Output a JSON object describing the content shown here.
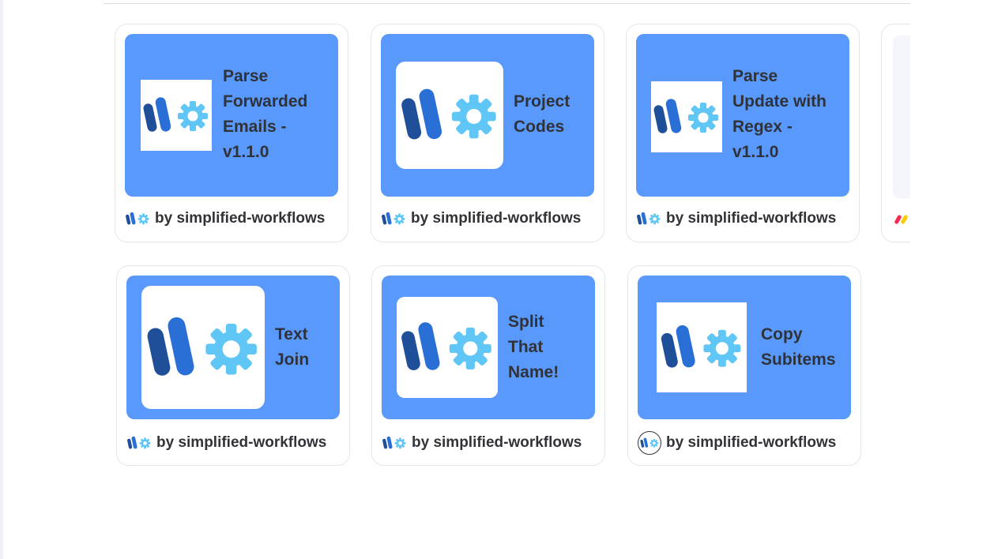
{
  "cards": [
    {
      "title": "Parse\nForwarded\nEmails -\nv1.1.0",
      "byline": "by simplified-workflows"
    },
    {
      "title": "Project\nCodes",
      "byline": "by simplified-workflows"
    },
    {
      "title": "Parse\nUpdate with\nRegex -\nv1.1.0",
      "byline": "by simplified-workflows"
    },
    {
      "title": "Text\nJoin",
      "byline": "by simplified-workflows"
    },
    {
      "title": "Split\nThat\nName!",
      "byline": "by simplified-workflows"
    },
    {
      "title": "Copy\nSubitems",
      "byline": "by simplified-workflows"
    }
  ],
  "colors": {
    "banner": "#5899fb",
    "logo_dark": "#1f4f99",
    "logo_mid": "#2a6fd6",
    "logo_gear": "#5fc6f6"
  },
  "icons": [
    "simplified-workflows-logo-icon",
    "gear-icon",
    "monday-logo-icon"
  ]
}
